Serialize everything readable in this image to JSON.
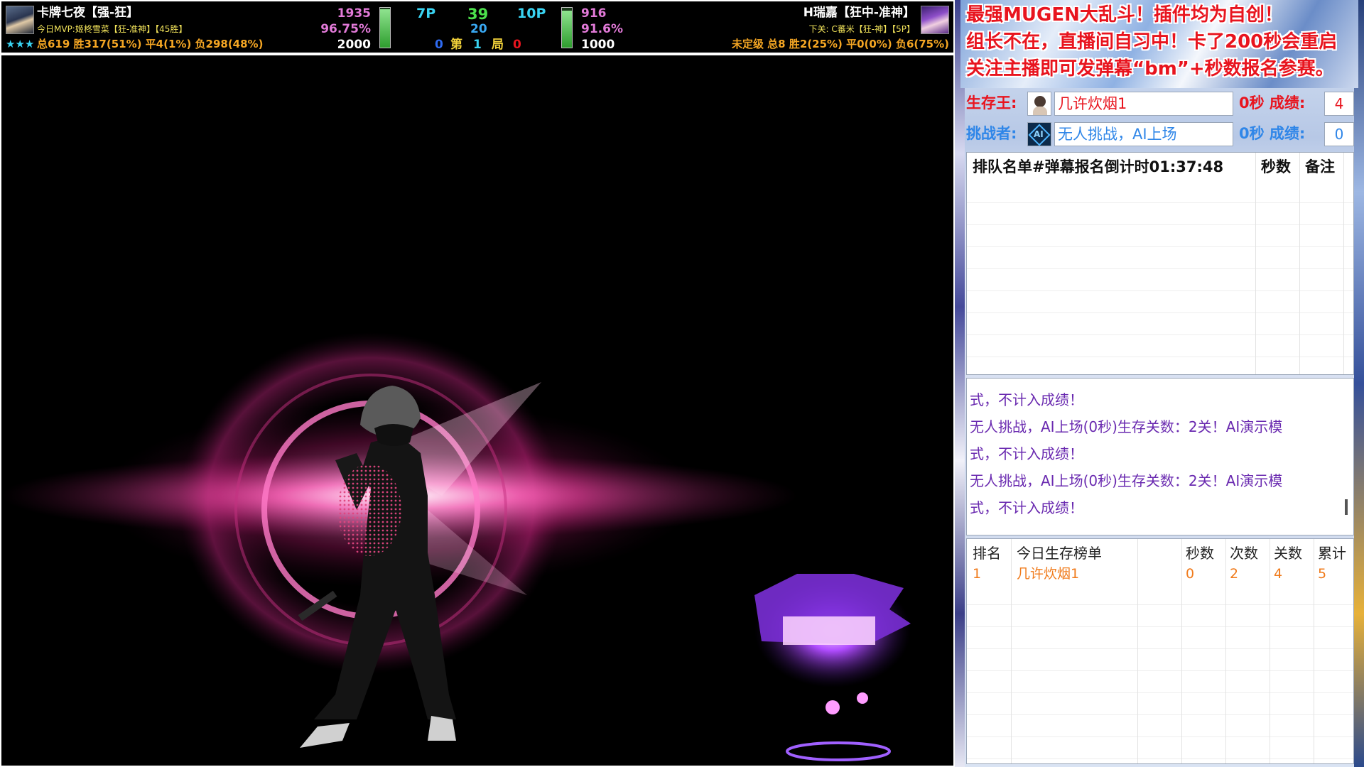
{
  "hud": {
    "p1": {
      "name": "卡牌七夜【强-狂】",
      "mvp": "今日MVP:姬柊雪菜【狂-准神】【45胜】",
      "stars": "★★★",
      "record": "总619 胜317(51%) 平4(1%) 负298(48%)",
      "num_top": "1935",
      "num_mid": "96.75%",
      "num_bot": "2000",
      "power_fraction": 0.97
    },
    "center": {
      "left_label": "7P",
      "right_label": "10P",
      "top_number": "39",
      "mid_number": "20",
      "round_left": "0",
      "round_word_1": "第",
      "round_num": "1",
      "round_word_2": "局",
      "round_right": "0"
    },
    "p2": {
      "name": "H瑞嘉【狂中-准神】",
      "next": "下关: C蕃米【狂-神】【5P】",
      "record": "未定级 总8 胜2(25%) 平0(0%) 负6(75%)",
      "num_top": "916",
      "num_mid": "91.6%",
      "num_bot": "1000",
      "power_fraction": 0.92
    }
  },
  "banner": {
    "line1": "最强MUGEN大乱斗！插件均为自创！",
    "line2": "组长不在，直播间自习中！卡了200秒会重启",
    "line3": "关注主播即可发弹幕“bm”+秒数报名参赛。"
  },
  "survivor": {
    "label": "生存王:",
    "name": "几许炊烟1",
    "stat": "0秒 成绩:",
    "score": "4",
    "icon": "user-avatar-icon"
  },
  "challenger": {
    "label": "挑战者:",
    "name": "无人挑战，AI上场",
    "stat": "0秒 成绩:",
    "score": "0",
    "icon": "ai-icon"
  },
  "queue": {
    "col1": "排队名单#弹幕报名倒计时01:37:48",
    "col2": "秒数",
    "col3": "备注"
  },
  "log": {
    "lines": [
      "式，不计入成绩！",
      "无人挑战，AI上场(0秒)生存关数：2关！AI演示模",
      "式，不计入成绩！",
      "无人挑战，AI上场(0秒)生存关数：2关！AI演示模",
      "式，不计入成绩！"
    ]
  },
  "ranking": {
    "headers": [
      "排名",
      "今日生存榜单",
      "秒数",
      "次数",
      "关数",
      "累计"
    ],
    "rows": [
      [
        "1",
        "几许炊烟1",
        "0",
        "2",
        "4",
        "5"
      ]
    ]
  },
  "colors": {
    "red": "#e8141e",
    "blue": "#2f86e8",
    "purple": "#6a2ab0",
    "orange": "#f07a1a"
  }
}
